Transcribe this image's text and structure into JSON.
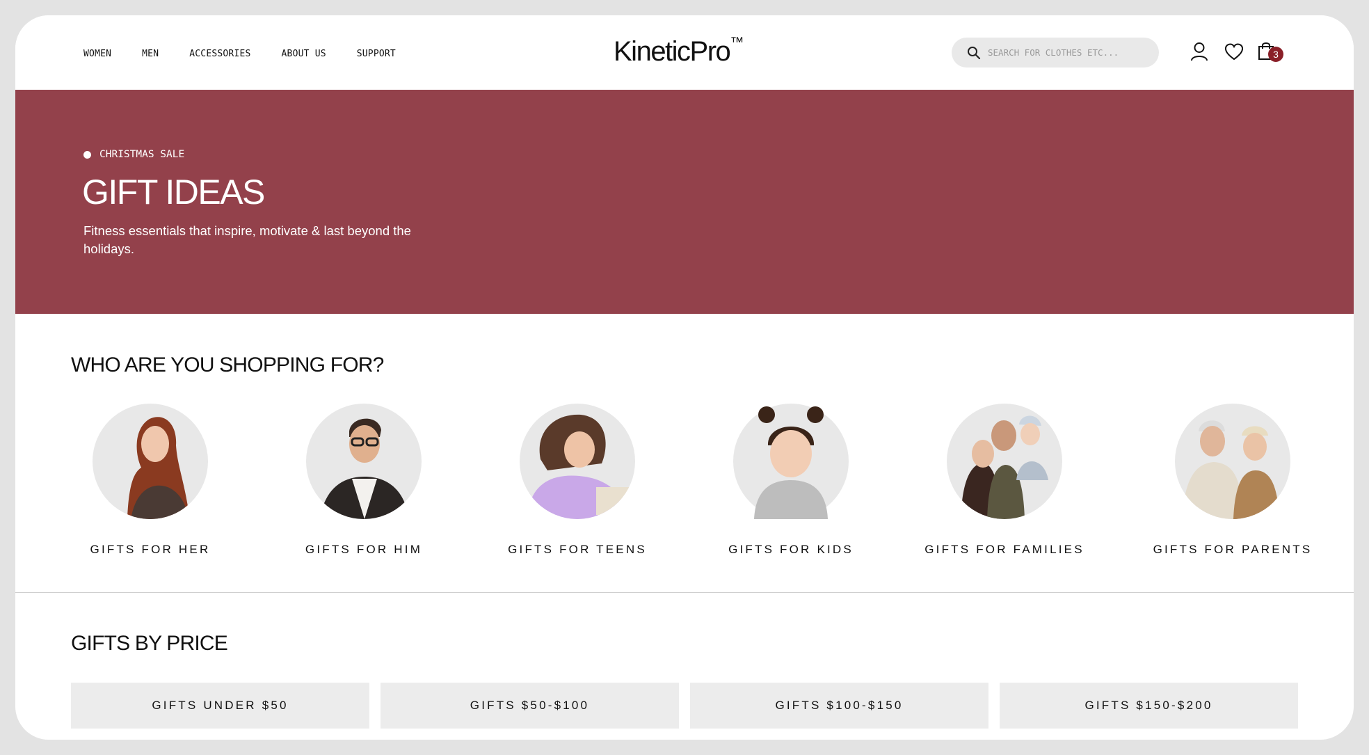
{
  "header": {
    "nav": [
      "WOMEN",
      "MEN",
      "ACCESSORIES",
      "ABOUT US",
      "SUPPORT"
    ],
    "logo": "KineticPro",
    "logo_mark": "™",
    "search_placeholder": "SEARCH FOR CLOTHES ETC...",
    "cart_count": "3",
    "icons": [
      "search-icon",
      "account-icon",
      "heart-icon",
      "shopping-bag-icon"
    ]
  },
  "hero": {
    "eyebrow": "CHRISTMAS SALE",
    "title": "GIFT IDEAS",
    "subtitle": "Fitness essentials that inspire, motivate & last beyond the holidays.",
    "background": "#93414b"
  },
  "shopping_for": {
    "title": "WHO ARE YOU SHOPPING FOR?",
    "categories": [
      "GIFTS FOR HER",
      "GIFTS FOR HIM",
      "GIFTS FOR TEENS",
      "GIFTS FOR KIDS",
      "GIFTS FOR FAMILIES",
      "GIFTS FOR PARENTS"
    ]
  },
  "by_price": {
    "title": "GIFTS BY PRICE",
    "options": [
      "GIFTS UNDER $50",
      "GIFTS $50-$100",
      "GIFTS $100-$150",
      "GIFTS $150-$200"
    ]
  },
  "colors": {
    "accent": "#93414b",
    "badge": "#8a1f28",
    "tile": "#ececec"
  }
}
